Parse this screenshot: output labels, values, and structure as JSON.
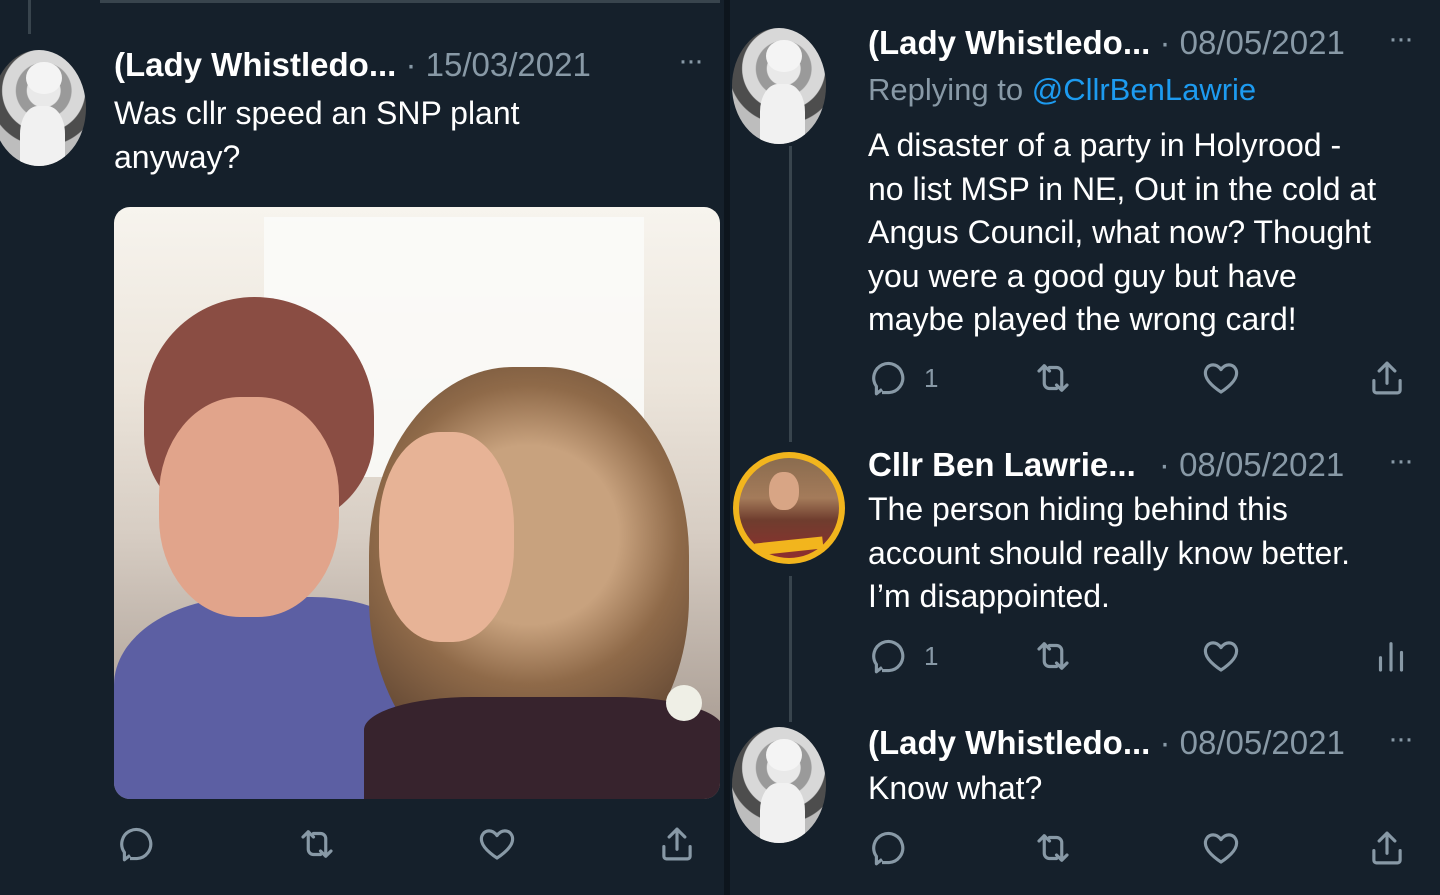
{
  "left_tweet": {
    "author": "(Lady Whistledo...",
    "date": "· 15/03/2021",
    "more": "···",
    "text_line1": "Was cllr speed an SNP plant",
    "text_line2": "anyway?",
    "avatar_icon": "profile-photo-icon",
    "photo_desc_icon": "attached-photo",
    "actions": {
      "reply_count": "",
      "retweet_count": "",
      "like_count": ""
    }
  },
  "thread": [
    {
      "author": "(Lady Whistledo...",
      "date": "· 08/05/2021",
      "more": "···",
      "replying_prefix": "Replying to ",
      "replying_handle": "@CllrBenLawrie",
      "lines": [
        "A disaster of a party in Holyrood -",
        "no list MSP in NE, Out in the cold at",
        "Angus Council, what now? Thought",
        "you were a good guy but have",
        "maybe played the wrong card!"
      ],
      "reply_count": "1",
      "last_action_icon": "share-icon"
    },
    {
      "author": "Cllr Ben Lawrie...",
      "date": "· 08/05/2021",
      "more": "···",
      "lines": [
        "The person hiding behind this",
        "account should really know better.",
        "I’m disappointed."
      ],
      "reply_count": "1",
      "last_action_icon": "analytics-icon"
    },
    {
      "author": "(Lady Whistledo...",
      "date": "· 08/05/2021",
      "more": "···",
      "lines": [
        "Know what?"
      ],
      "reply_count": "",
      "last_action_icon": "share-icon"
    }
  ],
  "colors": {
    "background": "#15202b",
    "muted": "#8899a6",
    "link": "#1d9bf0",
    "accent_ring": "#f2b51d"
  }
}
